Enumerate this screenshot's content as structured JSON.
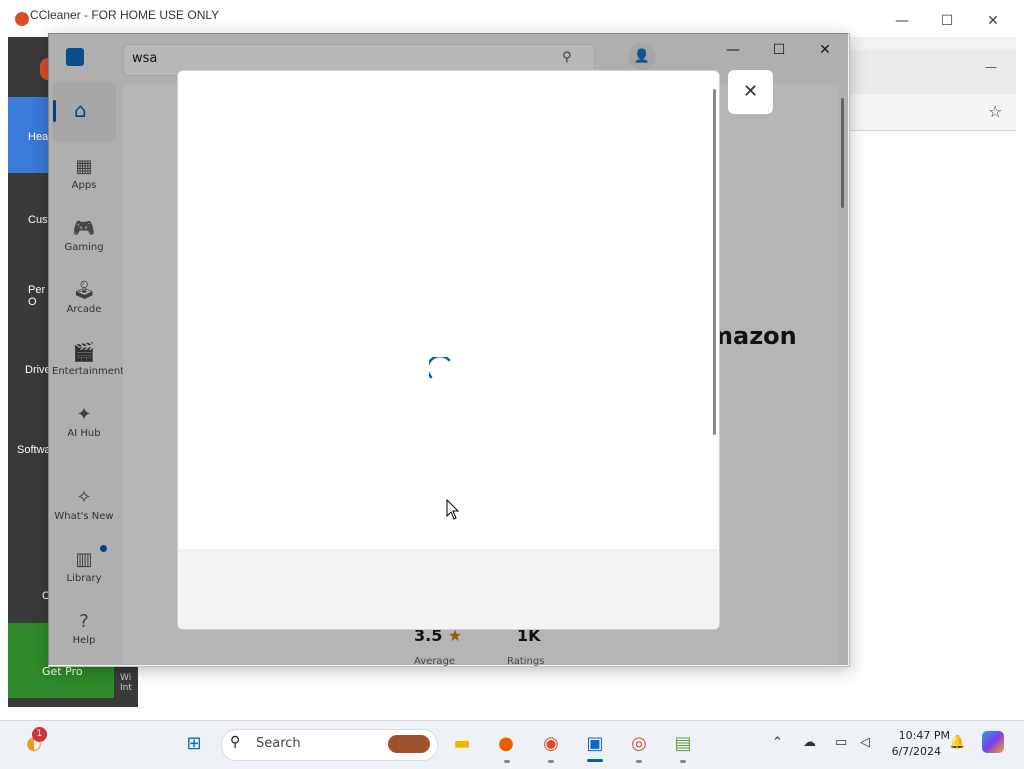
{
  "ccleaner": {
    "title": "CCleaner - FOR HOME USE ONLY",
    "nav": [
      "Hea",
      "Cust",
      "Per\nO",
      "Drive",
      "Softwa",
      "C"
    ],
    "get_pro": "Get Pro",
    "bottom_text": "Wi\nInt"
  },
  "store": {
    "search_value": "wsa",
    "sidebar": [
      {
        "label": "Apps",
        "icon": "apps-icon"
      },
      {
        "label": "Gaming",
        "icon": "gamepad-icon"
      },
      {
        "label": "Arcade",
        "icon": "joystick-icon"
      },
      {
        "label": "Entertainment",
        "icon": "clapper-icon"
      },
      {
        "label": "AI Hub",
        "icon": "sparkle-icon"
      },
      {
        "label": "What's New",
        "icon": "megaphone-icon"
      },
      {
        "label": "Library",
        "icon": "library-icon"
      },
      {
        "label": "Help",
        "icon": "help-icon"
      }
    ],
    "background": {
      "brand_fragment": "mazon",
      "rating_value": "3.5",
      "rating_label": "Average",
      "ratings_count": "1K",
      "ratings_label": "Ratings"
    }
  },
  "taskbar": {
    "search_placeholder": "Search",
    "time": "10:47 PM",
    "date": "6/7/2024",
    "badge_count": "1"
  },
  "colors": {
    "accent": "#005fb8",
    "cc_sidebar": "#3a3a3a",
    "cc_active": "#3a7ad8",
    "cc_getpro": "#2e8a2a"
  }
}
